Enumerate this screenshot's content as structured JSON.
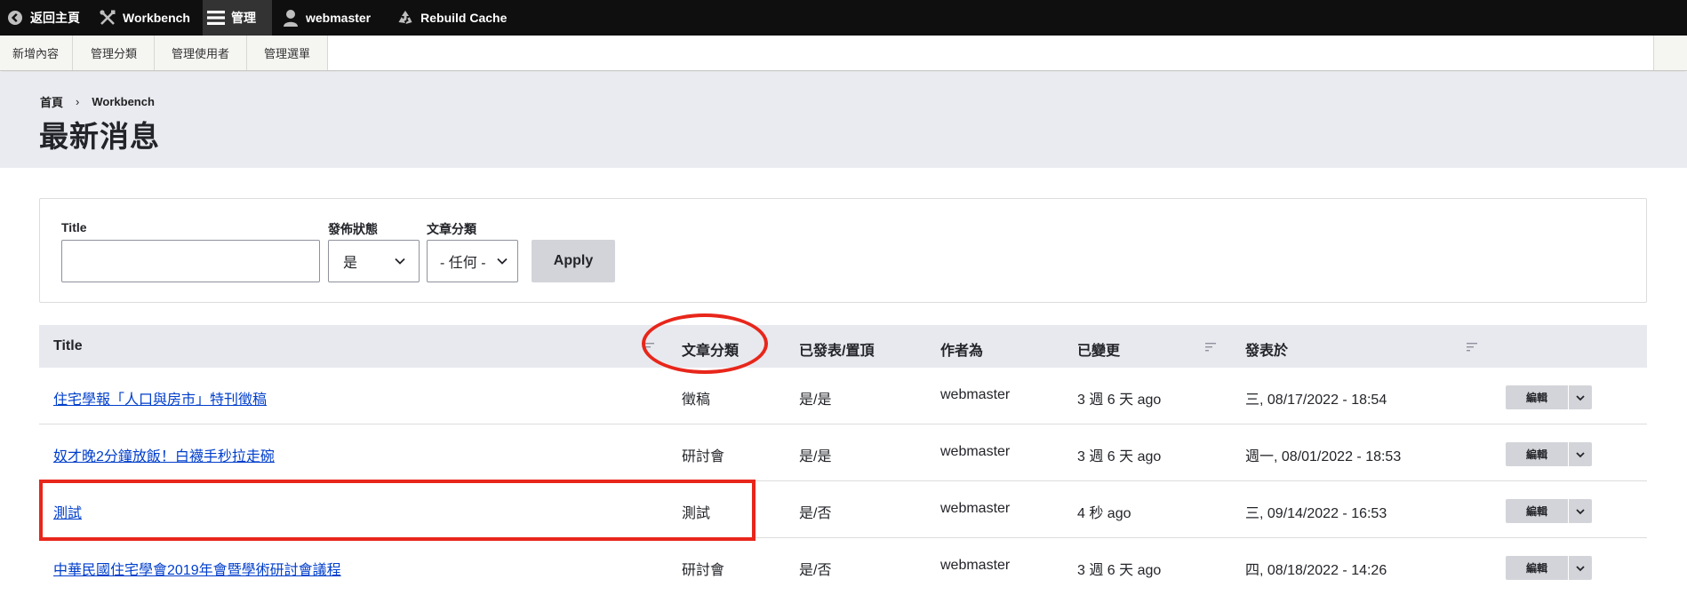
{
  "toolbar": {
    "items": [
      {
        "label": "返回主頁",
        "icon": "back-circle-icon"
      },
      {
        "label": "Workbench",
        "icon": "tools-icon"
      },
      {
        "label": "管理",
        "icon": "menu-icon"
      },
      {
        "label": "webmaster",
        "icon": "user-icon"
      },
      {
        "label": "Rebuild Cache",
        "icon": "recycle-icon"
      }
    ]
  },
  "tray": {
    "items": [
      "新增內容",
      "管理分類",
      "管理使用者",
      "管理選單"
    ]
  },
  "breadcrumb": {
    "home": "首頁",
    "separator": "›",
    "current": "Workbench"
  },
  "page_title": "最新消息",
  "filter": {
    "title_label": "Title",
    "title_value": "",
    "status_label": "發佈狀態",
    "status_value": "是",
    "category_label": "文章分類",
    "category_value": "- 任何 -",
    "apply_label": "Apply"
  },
  "table": {
    "headers": {
      "title": "Title",
      "category": "文章分類",
      "published": "已發表/置頂",
      "author": "作者為",
      "changed": "已變更",
      "posted": "發表於"
    },
    "rows": [
      {
        "title": "住宅學報「人口與房市」特刊徵稿",
        "category": "徵稿",
        "published": "是/是",
        "author": "webmaster",
        "changed": "3 週 6 天 ago",
        "posted": "三, 08/17/2022 - 18:54",
        "edit": "編輯"
      },
      {
        "title": "奴才晚2分鐘放飯！白襪手秒拉走碗",
        "category": "研討會",
        "published": "是/是",
        "author": "webmaster",
        "changed": "3 週 6 天 ago",
        "posted": "週一, 08/01/2022 - 18:53",
        "edit": "編輯"
      },
      {
        "title": "測試",
        "category": "測試",
        "published": "是/否",
        "author": "webmaster",
        "changed": "4 秒 ago",
        "posted": "三, 09/14/2022 - 16:53",
        "edit": "編輯"
      },
      {
        "title": "中華民國住宅學會2019年會暨學術研討會議程",
        "category": "研討會",
        "published": "是/否",
        "author": "webmaster",
        "changed": "3 週 6 天 ago",
        "posted": "四, 08/18/2022 - 14:26",
        "edit": "編輯"
      }
    ]
  },
  "colors": {
    "toolbar_bg": "#0f0f0f",
    "link": "#003ecc",
    "annotation": "#e8261b",
    "header_bg": "#e9ebf1"
  }
}
